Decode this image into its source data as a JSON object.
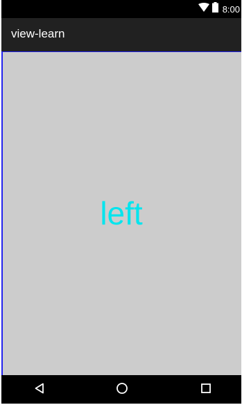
{
  "status_bar": {
    "time": "8:00",
    "wifi_icon": "wifi-icon",
    "battery_icon": "battery-icon"
  },
  "app_bar": {
    "title": "view-learn"
  },
  "content": {
    "label": "left",
    "background": "#cccccc",
    "text_color": "#00e5ee",
    "border_color": "#2222ee"
  },
  "nav_bar": {
    "back_icon": "back-icon",
    "home_icon": "home-icon",
    "recents_icon": "recents-icon"
  }
}
